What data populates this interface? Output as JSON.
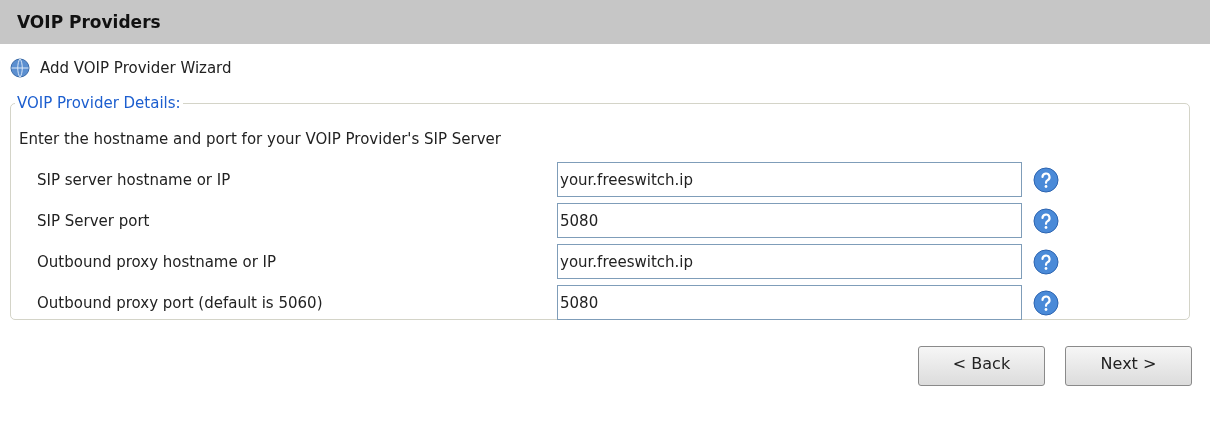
{
  "header": {
    "title": "VOIP Providers"
  },
  "wizard": {
    "title": "Add VOIP Provider Wizard"
  },
  "fieldset": {
    "legend": "VOIP Provider Details:",
    "description": "Enter the hostname and port for your VOIP Provider's SIP Server",
    "fields": [
      {
        "label": "SIP server hostname or IP",
        "value": "your.freeswitch.ip"
      },
      {
        "label": "SIP Server port",
        "value": "5080"
      },
      {
        "label": "Outbound proxy hostname or IP",
        "value": "your.freeswitch.ip"
      },
      {
        "label": "Outbound proxy port (default is 5060)",
        "value": "5080"
      }
    ]
  },
  "buttons": [
    {
      "label": "< Back"
    },
    {
      "label": "Next >"
    }
  ]
}
